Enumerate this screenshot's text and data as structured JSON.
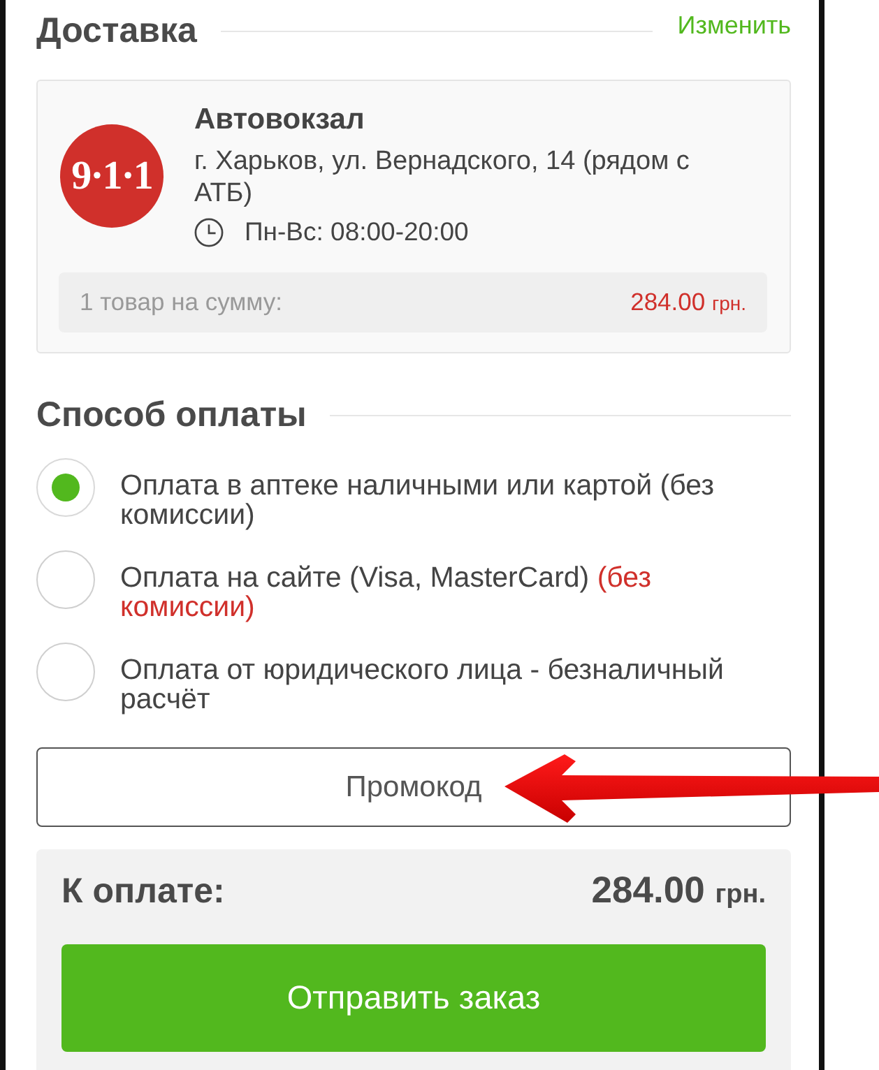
{
  "delivery": {
    "title": "Доставка",
    "change_link": "Изменить",
    "point": {
      "logo_text": "9·1·1",
      "name": "Автовокзал",
      "address": "г. Харьков, ул. Вернадского, 14 (рядом с АТБ)",
      "hours": "Пн-Вс: 08:00-20:00"
    },
    "summary": {
      "label": "1 товар на сумму:",
      "amount": "284.00",
      "currency": "грн."
    }
  },
  "payment": {
    "title": "Способ оплаты",
    "options": [
      {
        "label": "Оплата в аптеке наличными или картой (без комиссии)",
        "selected": true
      },
      {
        "label": "Оплата на сайте (Visa, MasterCard)",
        "note": "(без комиссии)",
        "selected": false
      },
      {
        "label": "Оплата от юридического лица - безналичный расчёт",
        "selected": false
      }
    ]
  },
  "promo_button": "Промокод",
  "total": {
    "label": "К оплате:",
    "amount": "284.00",
    "currency": "грн.",
    "submit_button": "Отправить заказ"
  }
}
